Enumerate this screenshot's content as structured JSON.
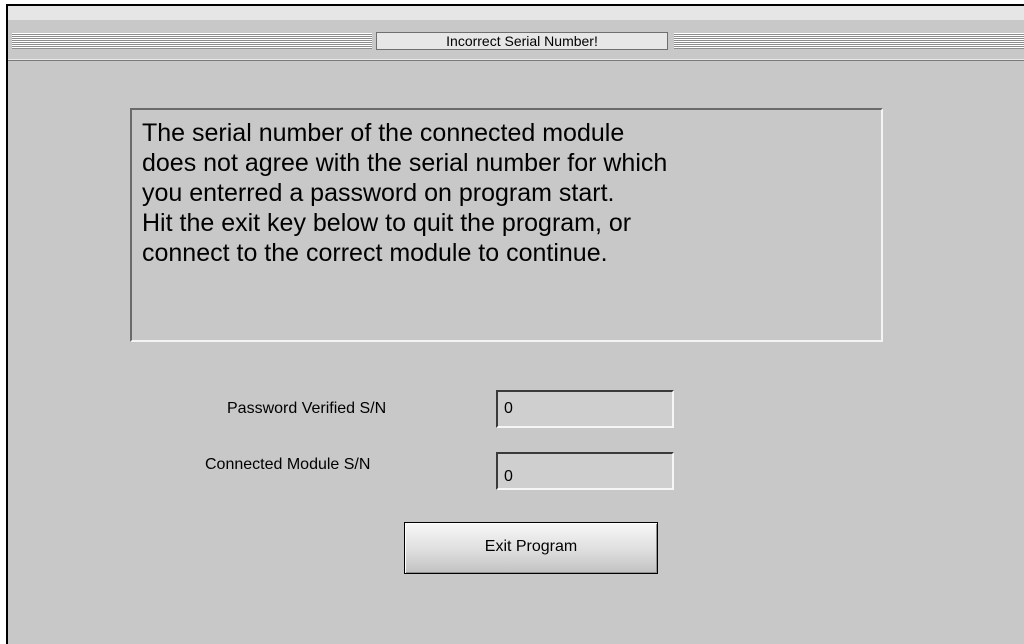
{
  "dialog": {
    "title": "Incorrect Serial Number!",
    "message_lines": [
      "The serial number of the connected module",
      "does not agree with the serial number for which",
      "you enterred a password on program start.",
      "Hit the exit key below to quit the program, or",
      "connect to the correct module to continue."
    ]
  },
  "fields": {
    "password_verified_label": "Password Verified S/N",
    "password_verified_value": "0",
    "connected_module_label": "Connected Module S/N",
    "connected_module_value": "0"
  },
  "buttons": {
    "exit_label": "Exit Program"
  },
  "colors": {
    "panel_background": "#c8c8c8",
    "field_background": "#cfcfcf"
  }
}
